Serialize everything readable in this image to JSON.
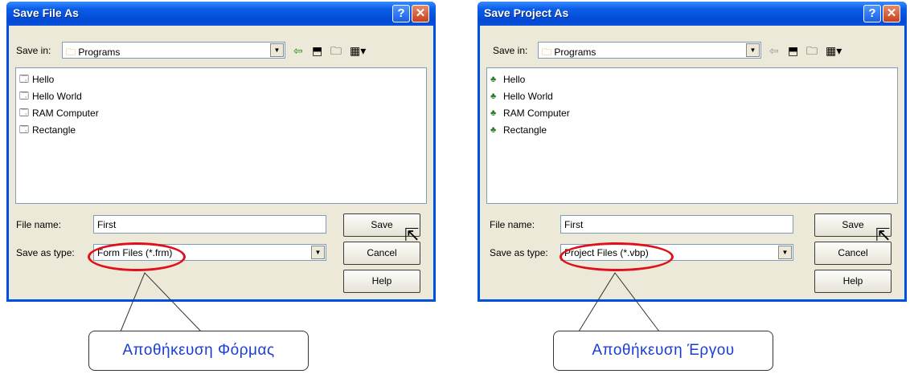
{
  "dialogs": [
    {
      "title": "Save File As",
      "save_in_label": "Save in:",
      "save_in_value": "Programs",
      "items": [
        {
          "label": "Hello",
          "icon": "form-icon"
        },
        {
          "label": "Hello World",
          "icon": "form-icon"
        },
        {
          "label": "RAM Computer",
          "icon": "form-icon"
        },
        {
          "label": "Rectangle",
          "icon": "form-icon"
        }
      ],
      "file_name_label": "File name:",
      "file_name_value": "First",
      "save_as_type_label": "Save as type:",
      "save_as_type_value": "Form Files (*.frm)",
      "save_button": "Save",
      "cancel_button": "Cancel",
      "help_button": "Help",
      "callout": "Αποθήκευση  Φόρμας"
    },
    {
      "title": "Save Project As",
      "save_in_label": "Save in:",
      "save_in_value": "Programs",
      "items": [
        {
          "label": "Hello",
          "icon": "project-icon"
        },
        {
          "label": "Hello World",
          "icon": "project-icon"
        },
        {
          "label": "RAM Computer",
          "icon": "project-icon"
        },
        {
          "label": "Rectangle",
          "icon": "project-icon"
        }
      ],
      "file_name_label": "File name:",
      "file_name_value": "First",
      "save_as_type_label": "Save as type:",
      "save_as_type_value": "Project Files (*.vbp)",
      "save_button": "Save",
      "cancel_button": "Cancel",
      "help_button": "Help",
      "callout": "Αποθήκευση  Έργου"
    }
  ],
  "colors": {
    "titlebar": "#0a5ee8",
    "highlight_ellipse": "#e0101a",
    "callout_text": "#1a3fd0"
  }
}
